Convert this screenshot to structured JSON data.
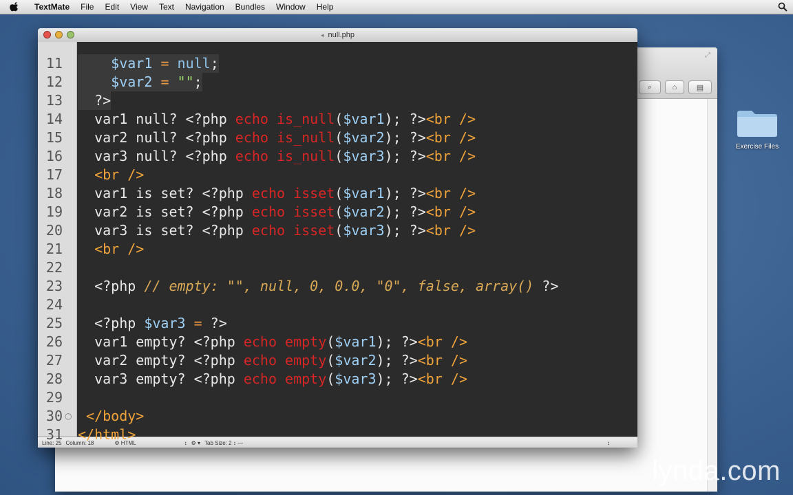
{
  "menubar": {
    "items": [
      "TextMate",
      "File",
      "Edit",
      "View",
      "Text",
      "Navigation",
      "Bundles",
      "Window",
      "Help"
    ]
  },
  "editor": {
    "title": "null.php",
    "lines": [
      {
        "n": "11",
        "segs": [
          [
            "t-plain",
            "    "
          ],
          [
            "t-var",
            "$var1"
          ],
          [
            "t-plain",
            " "
          ],
          [
            "t-op",
            "="
          ],
          [
            "t-plain",
            " "
          ],
          [
            "t-const",
            "null"
          ],
          [
            "t-plain",
            ";"
          ]
        ],
        "hl": true
      },
      {
        "n": "12",
        "segs": [
          [
            "t-plain",
            "    "
          ],
          [
            "t-var",
            "$var2"
          ],
          [
            "t-plain",
            " "
          ],
          [
            "t-op",
            "="
          ],
          [
            "t-plain",
            " "
          ],
          [
            "t-str",
            "\"\""
          ],
          [
            "t-plain",
            ";"
          ]
        ],
        "hl": true
      },
      {
        "n": "13",
        "segs": [
          [
            "t-plain",
            "  ?>"
          ]
        ],
        "hl": true
      },
      {
        "n": "14",
        "segs": [
          [
            "t-plain",
            "  var1 null? <?php "
          ],
          [
            "t-fn",
            "echo is_null"
          ],
          [
            "t-plain",
            "("
          ],
          [
            "t-var",
            "$var1"
          ],
          [
            "t-plain",
            "); ?>"
          ],
          [
            "t-tag",
            "<br />"
          ]
        ]
      },
      {
        "n": "15",
        "segs": [
          [
            "t-plain",
            "  var2 null? <?php "
          ],
          [
            "t-fn",
            "echo is_null"
          ],
          [
            "t-plain",
            "("
          ],
          [
            "t-var",
            "$var2"
          ],
          [
            "t-plain",
            "); ?>"
          ],
          [
            "t-tag",
            "<br />"
          ]
        ]
      },
      {
        "n": "16",
        "segs": [
          [
            "t-plain",
            "  var3 null? <?php "
          ],
          [
            "t-fn",
            "echo is_null"
          ],
          [
            "t-plain",
            "("
          ],
          [
            "t-var",
            "$var3"
          ],
          [
            "t-plain",
            "); ?>"
          ],
          [
            "t-tag",
            "<br />"
          ]
        ]
      },
      {
        "n": "17",
        "segs": [
          [
            "t-plain",
            "  "
          ],
          [
            "t-tag",
            "<br />"
          ]
        ]
      },
      {
        "n": "18",
        "segs": [
          [
            "t-plain",
            "  var1 is set? <?php "
          ],
          [
            "t-fn",
            "echo isset"
          ],
          [
            "t-plain",
            "("
          ],
          [
            "t-var",
            "$var1"
          ],
          [
            "t-plain",
            "); ?>"
          ],
          [
            "t-tag",
            "<br />"
          ]
        ]
      },
      {
        "n": "19",
        "segs": [
          [
            "t-plain",
            "  var2 is set? <?php "
          ],
          [
            "t-fn",
            "echo isset"
          ],
          [
            "t-plain",
            "("
          ],
          [
            "t-var",
            "$var2"
          ],
          [
            "t-plain",
            "); ?>"
          ],
          [
            "t-tag",
            "<br />"
          ]
        ]
      },
      {
        "n": "20",
        "segs": [
          [
            "t-plain",
            "  var3 is set? <?php "
          ],
          [
            "t-fn",
            "echo isset"
          ],
          [
            "t-plain",
            "("
          ],
          [
            "t-var",
            "$var3"
          ],
          [
            "t-plain",
            "); ?>"
          ],
          [
            "t-tag",
            "<br />"
          ]
        ]
      },
      {
        "n": "21",
        "segs": [
          [
            "t-plain",
            "  "
          ],
          [
            "t-tag",
            "<br />"
          ]
        ]
      },
      {
        "n": "22",
        "segs": []
      },
      {
        "n": "23",
        "segs": [
          [
            "t-plain",
            "  <?php "
          ],
          [
            "t-com",
            "// empty: \"\", null, 0, 0.0, \"0\", false, array()"
          ],
          [
            "t-plain",
            " ?>"
          ]
        ]
      },
      {
        "n": "24",
        "segs": []
      },
      {
        "n": "25",
        "segs": [
          [
            "t-plain",
            "  <?php "
          ],
          [
            "t-var",
            "$var3"
          ],
          [
            "t-plain",
            " "
          ],
          [
            "t-op",
            "="
          ],
          [
            "t-plain",
            " ?>"
          ]
        ]
      },
      {
        "n": "26",
        "segs": [
          [
            "t-plain",
            "  var1 empty? <?php "
          ],
          [
            "t-fn",
            "echo empty"
          ],
          [
            "t-plain",
            "("
          ],
          [
            "t-var",
            "$var1"
          ],
          [
            "t-plain",
            "); ?>"
          ],
          [
            "t-tag",
            "<br />"
          ]
        ]
      },
      {
        "n": "27",
        "segs": [
          [
            "t-plain",
            "  var2 empty? <?php "
          ],
          [
            "t-fn",
            "echo empty"
          ],
          [
            "t-plain",
            "("
          ],
          [
            "t-var",
            "$var2"
          ],
          [
            "t-plain",
            "); ?>"
          ],
          [
            "t-tag",
            "<br />"
          ]
        ]
      },
      {
        "n": "28",
        "segs": [
          [
            "t-plain",
            "  var3 empty? <?php "
          ],
          [
            "t-fn",
            "echo empty"
          ],
          [
            "t-plain",
            "("
          ],
          [
            "t-var",
            "$var3"
          ],
          [
            "t-plain",
            "); ?>"
          ],
          [
            "t-tag",
            "<br />"
          ]
        ]
      },
      {
        "n": "29",
        "segs": []
      },
      {
        "n": "30",
        "segs": [
          [
            "t-plain",
            " "
          ],
          [
            "t-tag",
            "</body>"
          ]
        ],
        "fold": "○"
      },
      {
        "n": "31",
        "segs": [
          [
            "t-tag",
            "</html>"
          ]
        ]
      }
    ],
    "status": {
      "line": "Line: 25",
      "column": "Column: 18",
      "language": "HTML",
      "tab_size": "Tab Size:  2"
    }
  },
  "desktop": {
    "folder_label": "Exercise Files"
  },
  "watermark": "lynda.com",
  "colors": {
    "desktop": "#3e6491",
    "editor_bg": "#2b2b2b",
    "keyword_red": "#d82525",
    "tag_orange": "#f0a33a",
    "variable_blue": "#9fd0f5"
  }
}
